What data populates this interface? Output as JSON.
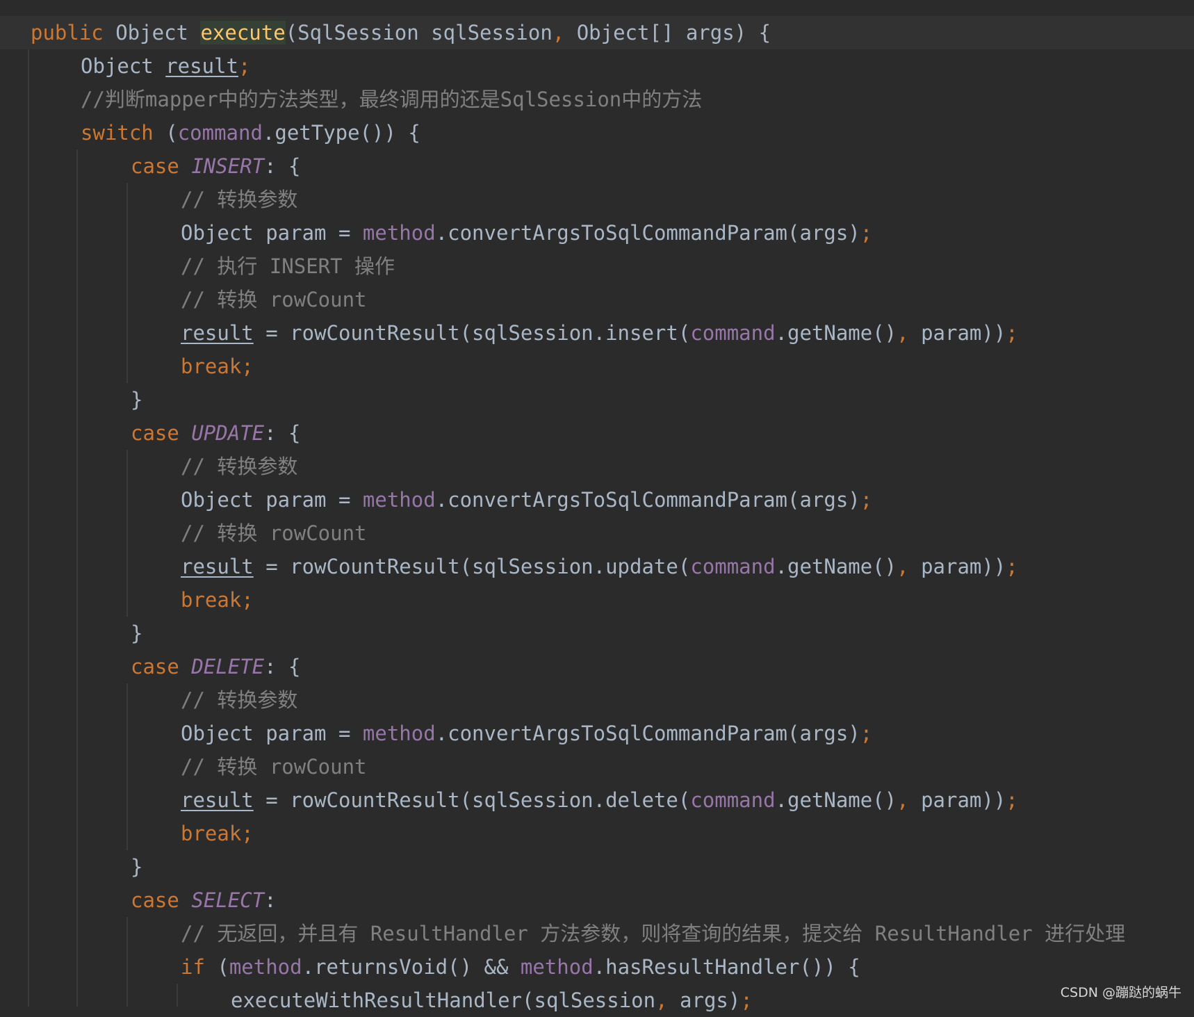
{
  "editor": {
    "lines": [
      {
        "indent": 0,
        "current": true,
        "tokens": [
          {
            "t": "public",
            "c": "kw"
          },
          {
            "t": " Object ",
            "c": "plain"
          },
          {
            "t": "execute",
            "c": "fn-hl"
          },
          {
            "t": "(SqlSession sqlSession",
            "c": "plain"
          },
          {
            "t": ",",
            "c": "kw"
          },
          {
            "t": " Object[] args) {",
            "c": "plain"
          }
        ]
      },
      {
        "indent": 1,
        "tokens": [
          {
            "t": "Object ",
            "c": "plain"
          },
          {
            "t": "result",
            "c": "plain ul"
          },
          {
            "t": ";",
            "c": "semi"
          }
        ]
      },
      {
        "indent": 1,
        "tokens": [
          {
            "t": "//判断mapper中的方法类型，最终调用的还是SqlSession中的方法",
            "c": "cm"
          }
        ]
      },
      {
        "indent": 1,
        "tokens": [
          {
            "t": "switch",
            "c": "kw"
          },
          {
            "t": " (",
            "c": "plain"
          },
          {
            "t": "command",
            "c": "fld"
          },
          {
            "t": ".getType()) {",
            "c": "plain"
          }
        ]
      },
      {
        "indent": 2,
        "tokens": [
          {
            "t": "case ",
            "c": "kw"
          },
          {
            "t": "INSERT",
            "c": "enum"
          },
          {
            "t": ": {",
            "c": "plain"
          }
        ]
      },
      {
        "indent": 3,
        "tokens": [
          {
            "t": "// 转换参数",
            "c": "cm"
          }
        ]
      },
      {
        "indent": 3,
        "tokens": [
          {
            "t": "Object param = ",
            "c": "plain"
          },
          {
            "t": "method",
            "c": "fld"
          },
          {
            "t": ".convertArgsToSqlCommandParam(args)",
            "c": "plain"
          },
          {
            "t": ";",
            "c": "semi"
          }
        ]
      },
      {
        "indent": 3,
        "tokens": [
          {
            "t": "// 执行 INSERT 操作",
            "c": "cm"
          }
        ]
      },
      {
        "indent": 3,
        "tokens": [
          {
            "t": "// 转换 rowCount",
            "c": "cm"
          }
        ]
      },
      {
        "indent": 3,
        "tokens": [
          {
            "t": "result",
            "c": "plain ul"
          },
          {
            "t": " = rowCountResult(sqlSession.insert(",
            "c": "plain"
          },
          {
            "t": "command",
            "c": "fld"
          },
          {
            "t": ".getName()",
            "c": "plain"
          },
          {
            "t": ",",
            "c": "kw"
          },
          {
            "t": " param))",
            "c": "plain"
          },
          {
            "t": ";",
            "c": "semi"
          }
        ]
      },
      {
        "indent": 3,
        "tokens": [
          {
            "t": "break;",
            "c": "kw"
          }
        ]
      },
      {
        "indent": 2,
        "tokens": [
          {
            "t": "}",
            "c": "plain"
          }
        ]
      },
      {
        "indent": 2,
        "tokens": [
          {
            "t": "case ",
            "c": "kw"
          },
          {
            "t": "UPDATE",
            "c": "enum"
          },
          {
            "t": ": {",
            "c": "plain"
          }
        ]
      },
      {
        "indent": 3,
        "tokens": [
          {
            "t": "// 转换参数",
            "c": "cm"
          }
        ]
      },
      {
        "indent": 3,
        "tokens": [
          {
            "t": "Object param = ",
            "c": "plain"
          },
          {
            "t": "method",
            "c": "fld"
          },
          {
            "t": ".convertArgsToSqlCommandParam(args)",
            "c": "plain"
          },
          {
            "t": ";",
            "c": "semi"
          }
        ]
      },
      {
        "indent": 3,
        "tokens": [
          {
            "t": "// 转换 rowCount",
            "c": "cm"
          }
        ]
      },
      {
        "indent": 3,
        "tokens": [
          {
            "t": "result",
            "c": "plain ul"
          },
          {
            "t": " = rowCountResult(sqlSession.update(",
            "c": "plain"
          },
          {
            "t": "command",
            "c": "fld"
          },
          {
            "t": ".getName()",
            "c": "plain"
          },
          {
            "t": ",",
            "c": "kw"
          },
          {
            "t": " param))",
            "c": "plain"
          },
          {
            "t": ";",
            "c": "semi"
          }
        ]
      },
      {
        "indent": 3,
        "tokens": [
          {
            "t": "break;",
            "c": "kw"
          }
        ]
      },
      {
        "indent": 2,
        "tokens": [
          {
            "t": "}",
            "c": "plain"
          }
        ]
      },
      {
        "indent": 2,
        "tokens": [
          {
            "t": "case ",
            "c": "kw"
          },
          {
            "t": "DELETE",
            "c": "enum"
          },
          {
            "t": ": {",
            "c": "plain"
          }
        ]
      },
      {
        "indent": 3,
        "tokens": [
          {
            "t": "// 转换参数",
            "c": "cm"
          }
        ]
      },
      {
        "indent": 3,
        "tokens": [
          {
            "t": "Object param = ",
            "c": "plain"
          },
          {
            "t": "method",
            "c": "fld"
          },
          {
            "t": ".convertArgsToSqlCommandParam(args)",
            "c": "plain"
          },
          {
            "t": ";",
            "c": "semi"
          }
        ]
      },
      {
        "indent": 3,
        "tokens": [
          {
            "t": "// 转换 rowCount",
            "c": "cm"
          }
        ]
      },
      {
        "indent": 3,
        "tokens": [
          {
            "t": "result",
            "c": "plain ul"
          },
          {
            "t": " = rowCountResult(sqlSession.delete(",
            "c": "plain"
          },
          {
            "t": "command",
            "c": "fld"
          },
          {
            "t": ".getName()",
            "c": "plain"
          },
          {
            "t": ",",
            "c": "kw"
          },
          {
            "t": " param))",
            "c": "plain"
          },
          {
            "t": ";",
            "c": "semi"
          }
        ]
      },
      {
        "indent": 3,
        "tokens": [
          {
            "t": "break;",
            "c": "kw"
          }
        ]
      },
      {
        "indent": 2,
        "tokens": [
          {
            "t": "}",
            "c": "plain"
          }
        ]
      },
      {
        "indent": 2,
        "tokens": [
          {
            "t": "case ",
            "c": "kw"
          },
          {
            "t": "SELECT",
            "c": "enum"
          },
          {
            "t": ":",
            "c": "plain"
          }
        ]
      },
      {
        "indent": 3,
        "tokens": [
          {
            "t": "// 无返回，并且有 ResultHandler 方法参数，则将查询的结果，提交给 ResultHandler 进行处理",
            "c": "cm"
          }
        ]
      },
      {
        "indent": 3,
        "tokens": [
          {
            "t": "if",
            "c": "kw"
          },
          {
            "t": " (",
            "c": "plain"
          },
          {
            "t": "method",
            "c": "fld"
          },
          {
            "t": ".returnsVoid() && ",
            "c": "plain"
          },
          {
            "t": "method",
            "c": "fld"
          },
          {
            "t": ".hasResultHandler()) {",
            "c": "plain"
          }
        ]
      },
      {
        "indent": 4,
        "tokens": [
          {
            "t": "executeWithResultHandler(sqlSession",
            "c": "plain"
          },
          {
            "t": ",",
            "c": "kw"
          },
          {
            "t": " args)",
            "c": "plain"
          },
          {
            "t": ";",
            "c": "semi"
          }
        ]
      }
    ]
  },
  "watermark": "CSDN @蹦跶的蜗牛",
  "colors": {
    "background": "#2b2b2b",
    "keyword": "#cc7832",
    "field": "#9876aa",
    "function": "#ffc66d",
    "comment": "#808080",
    "text": "#a9b7c6"
  }
}
